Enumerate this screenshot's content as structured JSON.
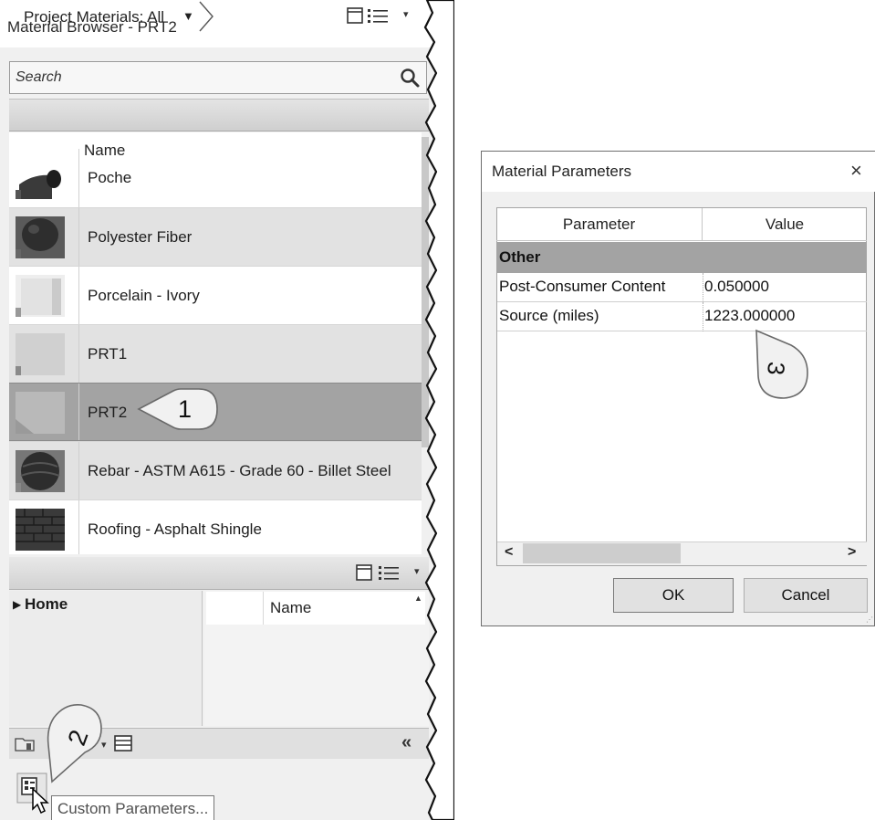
{
  "browser": {
    "title": "Material Browser - PRT2",
    "search": {
      "placeholder": "Search"
    },
    "filter": {
      "label": "Project Materials: All"
    },
    "list": {
      "header_name": "Name",
      "items": [
        {
          "label": "Poche"
        },
        {
          "label": "Polyester Fiber"
        },
        {
          "label": "Porcelain - Ivory"
        },
        {
          "label": "PRT1"
        },
        {
          "label": "PRT2",
          "selected": true
        },
        {
          "label": "Rebar - ASTM A615 - Grade 60 - Billet Steel"
        },
        {
          "label": "Roofing - Asphalt Shingle"
        }
      ]
    },
    "library": {
      "tree_root": "Home",
      "header_name": "Name"
    },
    "tooltip": "Custom Parameters..."
  },
  "callouts": {
    "one": "1",
    "two": "2",
    "three": "3"
  },
  "dialog": {
    "title": "Material Parameters",
    "close_glyph": "×",
    "columns": {
      "parameter": "Parameter",
      "value": "Value"
    },
    "group": "Other",
    "rows": [
      {
        "name": "Post-Consumer Content",
        "value": "0.050000"
      },
      {
        "name": "Source (miles)",
        "value": "1223.000000"
      }
    ],
    "ok_label": "OK",
    "cancel_label": "Cancel"
  },
  "colors": {
    "selected_row": "#a3a3a3",
    "group_row": "#a3a3a3",
    "panel_bg": "#f0f0f0"
  }
}
